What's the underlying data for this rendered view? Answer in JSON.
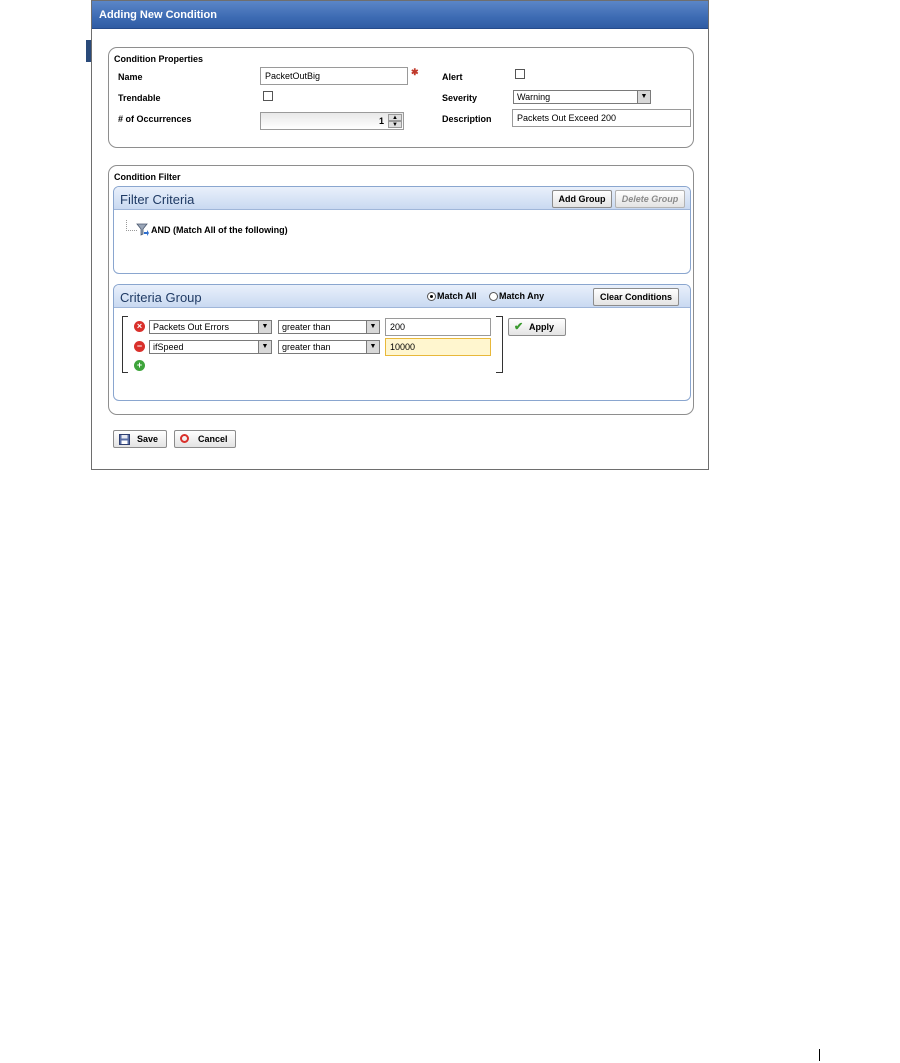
{
  "dialog": {
    "title": "Adding New Condition"
  },
  "properties": {
    "section_title": "Condition Properties",
    "name_label": "Name",
    "name_value": "PacketOutBig",
    "trendable_label": "Trendable",
    "trendable_checked": false,
    "occurrences_label": "# of Occurrences",
    "occurrences_value": "1",
    "alert_label": "Alert",
    "alert_checked": false,
    "severity_label": "Severity",
    "severity_value": "Warning",
    "description_label": "Description",
    "description_value": "Packets Out Exceed 200"
  },
  "filter": {
    "section_title": "Condition Filter",
    "criteria_title": "Filter Criteria",
    "add_group_label": "Add Group",
    "delete_group_label": "Delete Group",
    "tree_node_label": "AND (Match All of the following)"
  },
  "criteria_group": {
    "title": "Criteria Group",
    "match_all_label": "Match All",
    "match_any_label": "Match Any",
    "match_mode": "all",
    "clear_label": "Clear Conditions",
    "apply_label": "Apply",
    "rows": [
      {
        "attribute": "Packets Out Errors",
        "operator": "greater than",
        "value": "200"
      },
      {
        "attribute": "ifSpeed",
        "operator": "greater than",
        "value": "10000"
      }
    ]
  },
  "footer": {
    "save_label": "Save",
    "cancel_label": "Cancel"
  },
  "colors": {
    "titlebar": "#3d6bb3",
    "section_header": "#c9d9f1",
    "highlight_field": "#fff6cf",
    "remove_icon": "#d9302b",
    "add_icon": "#3ea43b"
  }
}
